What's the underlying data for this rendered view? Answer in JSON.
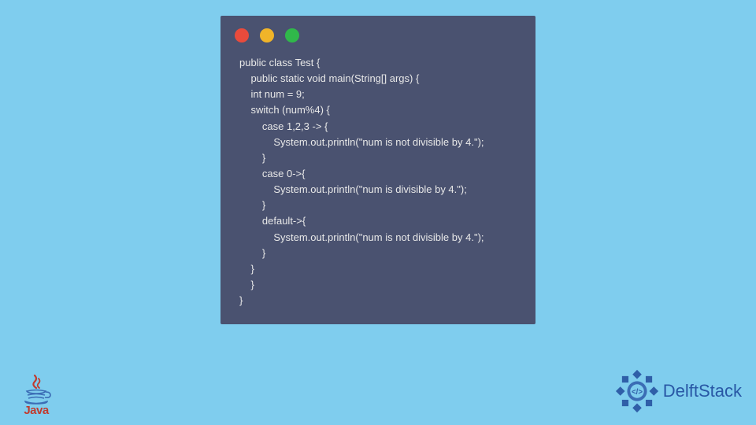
{
  "code": {
    "lines": [
      "public class Test {",
      "    public static void main(String[] args) {",
      "    int num = 9;",
      "    switch (num%4) {",
      "        case 1,2,3 -> {",
      "            System.out.println(\"num is not divisible by 4.\");",
      "        }",
      "        case 0->{",
      "            System.out.println(\"num is divisible by 4.\");",
      "        }",
      "        default->{",
      "            System.out.println(\"num is not divisible by 4.\");",
      "        }",
      "    }",
      "    }",
      "}"
    ]
  },
  "logos": {
    "java_label": "Java",
    "delft_label": "DelftStack"
  },
  "colors": {
    "page_bg": "#7fcdee",
    "window_bg": "#4a5270",
    "code_fg": "#e8e8e8",
    "dot_red": "#e94b3c",
    "dot_yellow": "#f0b429",
    "dot_green": "#30b84a",
    "java_red": "#c13b2e",
    "delft_blue": "#2857a5"
  }
}
